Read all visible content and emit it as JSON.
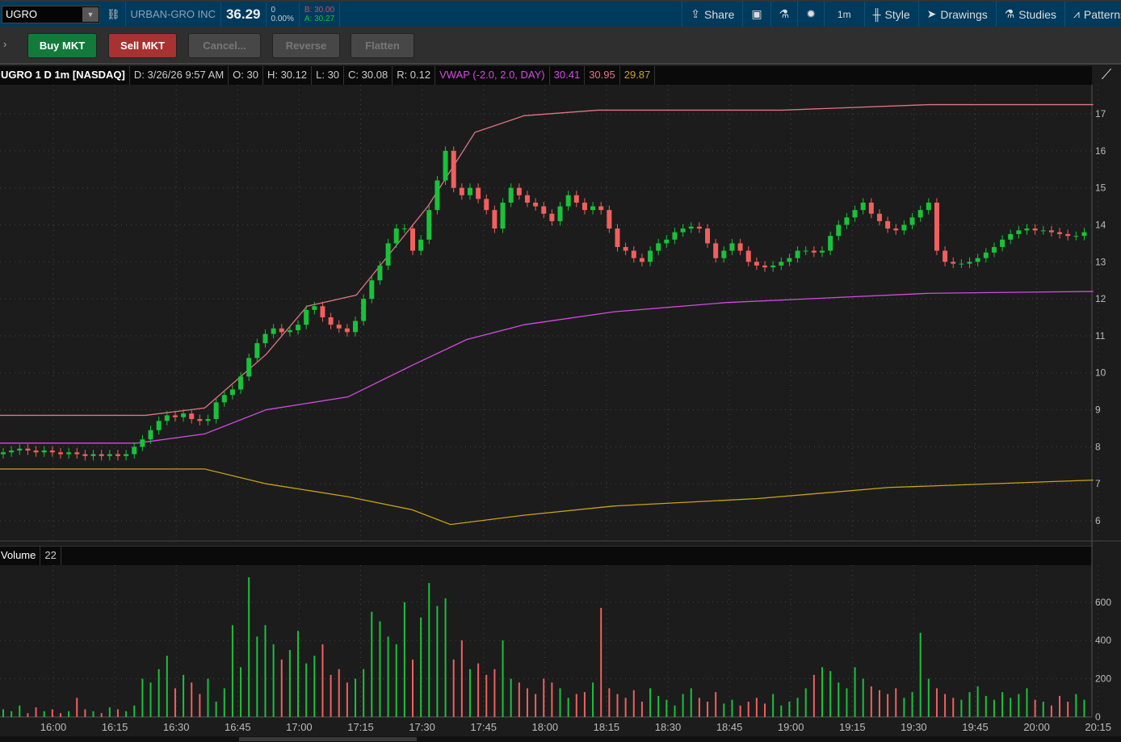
{
  "topbar": {
    "symbol": "UGRO",
    "company": "URBAN-GRO INC",
    "last": "36.29",
    "change": "0",
    "change_pct": "0.00%",
    "bid": "B: 30.00",
    "ask": "A: 30.27",
    "tools": [
      {
        "icon": "share-icon",
        "label": "Share"
      },
      {
        "icon": "calendar-alert-icon",
        "label": ""
      },
      {
        "icon": "flask-icon",
        "label": ""
      },
      {
        "icon": "gear-icon",
        "label": ""
      },
      {
        "icon": "",
        "label": "1m"
      },
      {
        "icon": "candle-style-icon",
        "label": "Style"
      },
      {
        "icon": "cursor-icon",
        "label": "Drawings"
      },
      {
        "icon": "studies-icon",
        "label": "Studies"
      },
      {
        "icon": "patterns-icon",
        "label": "Patterns"
      }
    ]
  },
  "trade": {
    "buy": "Buy MKT",
    "sell": "Sell MKT",
    "cancel": "Cancel...",
    "reverse": "Reverse",
    "flatten": "Flatten"
  },
  "header": {
    "title": "UGRO 1 D 1m [NASDAQ]",
    "date": "D: 3/26/26 9:57 AM",
    "open": "O: 30",
    "high": "H: 30.12",
    "low": "L: 30",
    "close": "C: 30.08",
    "range": "R: 0.12",
    "vwap": "VWAP (-2.0, 2.0, DAY)",
    "vwap_val": "30.41",
    "upper_val": "30.95",
    "lower_val": "29.87"
  },
  "volume": {
    "label": "Volume",
    "value": "22"
  },
  "colors": {
    "up": "#19c23a",
    "down": "#f0605e",
    "vwap": "#d24ce0",
    "upper": "#e07585",
    "lower": "#c9a21b"
  },
  "chart_data": {
    "type": "candlestick",
    "start_time": "15:47",
    "bar_minutes": 2,
    "y_ticks": [
      6,
      7,
      8,
      9,
      10,
      11,
      12,
      13,
      14,
      15,
      16,
      17
    ],
    "vol_ticks": [
      0,
      200,
      400,
      600
    ],
    "x_ticks": [
      "16:00",
      "16:15",
      "16:30",
      "16:45",
      "17:00",
      "17:15",
      "17:30",
      "17:45",
      "18:00",
      "18:15",
      "18:30",
      "18:45",
      "19:00",
      "19:15",
      "19:30",
      "19:45",
      "20:00",
      "20:15"
    ],
    "closes": [
      7.85,
      7.9,
      7.95,
      7.9,
      7.85,
      7.9,
      7.85,
      7.8,
      7.85,
      7.8,
      7.75,
      7.8,
      7.75,
      7.8,
      7.75,
      7.8,
      8.0,
      8.2,
      8.45,
      8.7,
      8.85,
      8.8,
      8.9,
      8.75,
      8.7,
      8.75,
      9.2,
      9.4,
      9.55,
      9.9,
      10.4,
      10.8,
      11.05,
      11.2,
      11.1,
      11.15,
      11.3,
      11.7,
      11.8,
      11.5,
      11.3,
      11.2,
      11.1,
      11.4,
      12.0,
      12.5,
      12.9,
      13.5,
      13.9,
      13.9,
      13.3,
      13.6,
      14.4,
      15.2,
      16.0,
      15.0,
      14.8,
      15.0,
      14.7,
      14.4,
      13.9,
      14.6,
      15.0,
      14.8,
      14.6,
      14.5,
      14.3,
      14.1,
      14.5,
      14.8,
      14.6,
      14.4,
      14.5,
      14.4,
      13.9,
      13.4,
      13.3,
      13.1,
      13.0,
      13.3,
      13.5,
      13.6,
      13.8,
      13.9,
      13.95,
      13.9,
      13.5,
      13.1,
      13.3,
      13.5,
      13.3,
      13.0,
      12.9,
      12.85,
      12.9,
      13.0,
      13.1,
      13.3,
      13.3,
      13.25,
      13.3,
      13.7,
      14.0,
      14.2,
      14.4,
      14.6,
      14.3,
      14.1,
      13.9,
      13.85,
      14.0,
      14.2,
      14.4,
      14.6,
      13.3,
      13.0,
      12.95,
      12.95,
      13.0,
      13.1,
      13.25,
      13.4,
      13.6,
      13.75,
      13.85,
      13.9,
      13.85,
      13.85,
      13.8,
      13.75,
      13.7,
      13.7,
      13.8
    ],
    "volumes": [
      40,
      30,
      60,
      20,
      50,
      30,
      40,
      20,
      30,
      100,
      40,
      30,
      20,
      50,
      40,
      30,
      60,
      200,
      180,
      250,
      320,
      150,
      220,
      180,
      120,
      200,
      80,
      150,
      480,
      260,
      730,
      420,
      480,
      380,
      300,
      350,
      450,
      280,
      320,
      380,
      220,
      250,
      180,
      200,
      250,
      550,
      500,
      420,
      380,
      600,
      300,
      520,
      700,
      580,
      620,
      300,
      400,
      250,
      280,
      220,
      250,
      400,
      200,
      180,
      150,
      120,
      200,
      180,
      150,
      100,
      120,
      130,
      180,
      570,
      150,
      120,
      100,
      140,
      80,
      150,
      110,
      90,
      60,
      120,
      150,
      100,
      80,
      130,
      70,
      90,
      60,
      80,
      100,
      70,
      120,
      60,
      80,
      100,
      150,
      220,
      260,
      240,
      180,
      150,
      260,
      200,
      160,
      140,
      120,
      150,
      100,
      130,
      440,
      200,
      150,
      120,
      100,
      90,
      130,
      160,
      110,
      90,
      130,
      100,
      120,
      150,
      90,
      80,
      60,
      110,
      80,
      120,
      90
    ],
    "upper_band": [
      [
        0,
        8.85
      ],
      [
        35.5,
        8.85
      ],
      [
        50,
        9.05
      ],
      [
        65,
        10.5
      ],
      [
        75,
        11.8
      ],
      [
        87,
        12.1
      ],
      [
        104.5,
        14.5
      ],
      [
        116,
        16.5
      ],
      [
        128,
        16.95
      ],
      [
        146,
        17.1
      ],
      [
        191,
        17.1
      ],
      [
        227,
        17.25
      ],
      [
        267,
        17.25
      ]
    ],
    "vwap_line": [
      [
        0,
        8.1
      ],
      [
        33.5,
        8.1
      ],
      [
        50,
        8.35
      ],
      [
        65,
        9.0
      ],
      [
        85,
        9.35
      ],
      [
        100.6,
        10.2
      ],
      [
        114,
        10.9
      ],
      [
        128,
        11.3
      ],
      [
        150,
        11.65
      ],
      [
        177.5,
        11.9
      ],
      [
        227,
        12.15
      ],
      [
        267,
        12.2
      ]
    ],
    "lower_band": [
      [
        0,
        7.4
      ],
      [
        50,
        7.4
      ],
      [
        65,
        7.0
      ],
      [
        85,
        6.65
      ],
      [
        100.6,
        6.3
      ],
      [
        110,
        5.9
      ],
      [
        128,
        6.15
      ],
      [
        150,
        6.4
      ],
      [
        185,
        6.6
      ],
      [
        217,
        6.9
      ],
      [
        267,
        7.1
      ]
    ]
  }
}
